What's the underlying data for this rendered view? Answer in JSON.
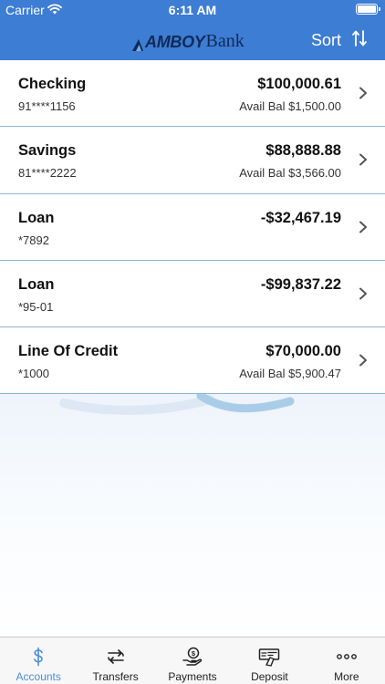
{
  "status_bar": {
    "carrier": "Carrier",
    "time": "6:11 AM"
  },
  "nav": {
    "logo_word_1": "AMBOY",
    "logo_word_2": "Bank",
    "sort_label": "Sort"
  },
  "accounts": [
    {
      "name": "Checking",
      "number": "91****1156",
      "balance": "$100,000.61",
      "available": "Avail Bal $1,500.00"
    },
    {
      "name": "Savings",
      "number": "81****2222",
      "balance": "$88,888.88",
      "available": "Avail Bal $3,566.00"
    },
    {
      "name": "Loan",
      "number": "*7892",
      "balance": "-$32,467.19",
      "available": ""
    },
    {
      "name": "Loan",
      "number": "*95-01",
      "balance": "-$99,837.22",
      "available": ""
    },
    {
      "name": "Line Of Credit",
      "number": "*1000",
      "balance": "$70,000.00",
      "available": "Avail Bal $5,900.47"
    }
  ],
  "tabs": [
    {
      "label": "Accounts",
      "icon": "dollar-icon",
      "active": true
    },
    {
      "label": "Transfers",
      "icon": "transfer-arrows-icon",
      "active": false
    },
    {
      "label": "Payments",
      "icon": "bill-pay-icon",
      "active": false
    },
    {
      "label": "Deposit",
      "icon": "check-deposit-icon",
      "active": false
    },
    {
      "label": "More",
      "icon": "more-dots-icon",
      "active": false
    }
  ],
  "colors": {
    "header": "#3d7dd3",
    "active_tab": "#4a8fd8",
    "divider": "#8fb6da",
    "logo": "#0f2a57"
  }
}
